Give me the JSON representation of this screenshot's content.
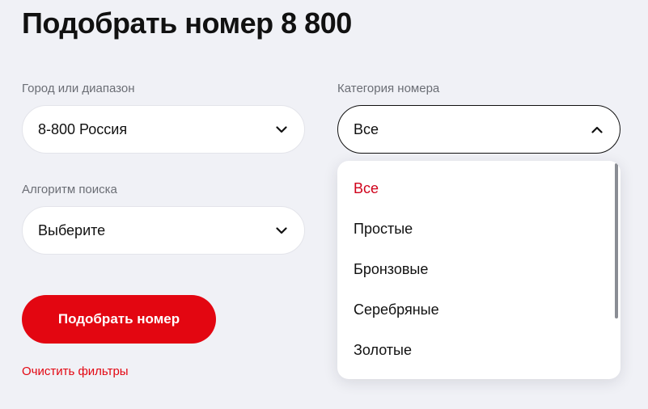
{
  "page": {
    "title": "Подобрать номер 8 800"
  },
  "filters": {
    "city": {
      "label": "Город или диапазон",
      "value": "8-800 Россия"
    },
    "category": {
      "label": "Категория номера",
      "value": "Все",
      "options": [
        "Все",
        "Простые",
        "Бронзовые",
        "Серебряные",
        "Золотые"
      ],
      "selected_index": 0
    },
    "algorithm": {
      "label": "Алгоритм поиска",
      "value": "Выберите"
    }
  },
  "actions": {
    "submit_label": "Подобрать номер",
    "clear_label": "Очистить фильтры"
  },
  "colors": {
    "accent": "#e30611",
    "selected_option": "#d0021b",
    "background": "#f0f1f6"
  },
  "icons": {
    "collapsed": "chevron-down-icon",
    "expanded": "chevron-up-icon"
  }
}
